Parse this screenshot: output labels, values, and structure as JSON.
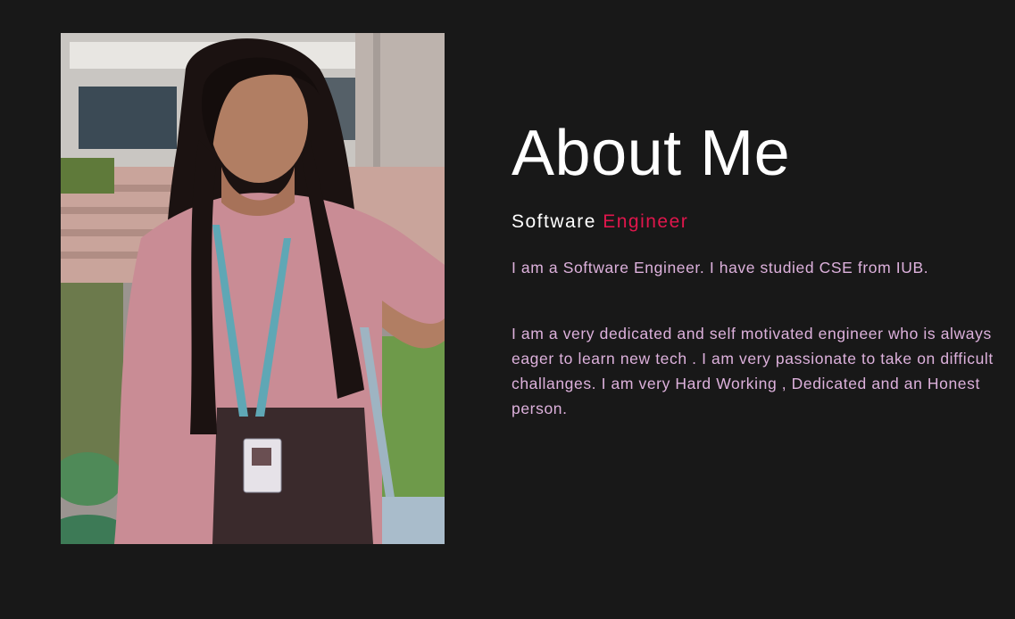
{
  "about": {
    "title": "About Me",
    "role_prefix": "Software",
    "role_highlight": "Engineer",
    "intro": "I am a Software Engineer. I have studied CSE from IUB.",
    "bio": "I am a very dedicated and self motivated engineer who is always eager to learn new tech . I am very passionate to take on difficult challanges. I am very Hard Working , Dedicated and an Honest person."
  },
  "colors": {
    "background": "#181818",
    "title": "#ffffff",
    "accent": "#e0164c",
    "paragraph": "#ddb1dc"
  },
  "portrait": {
    "subject": "woman in pink kurta with id badge, outdoor campus background"
  }
}
